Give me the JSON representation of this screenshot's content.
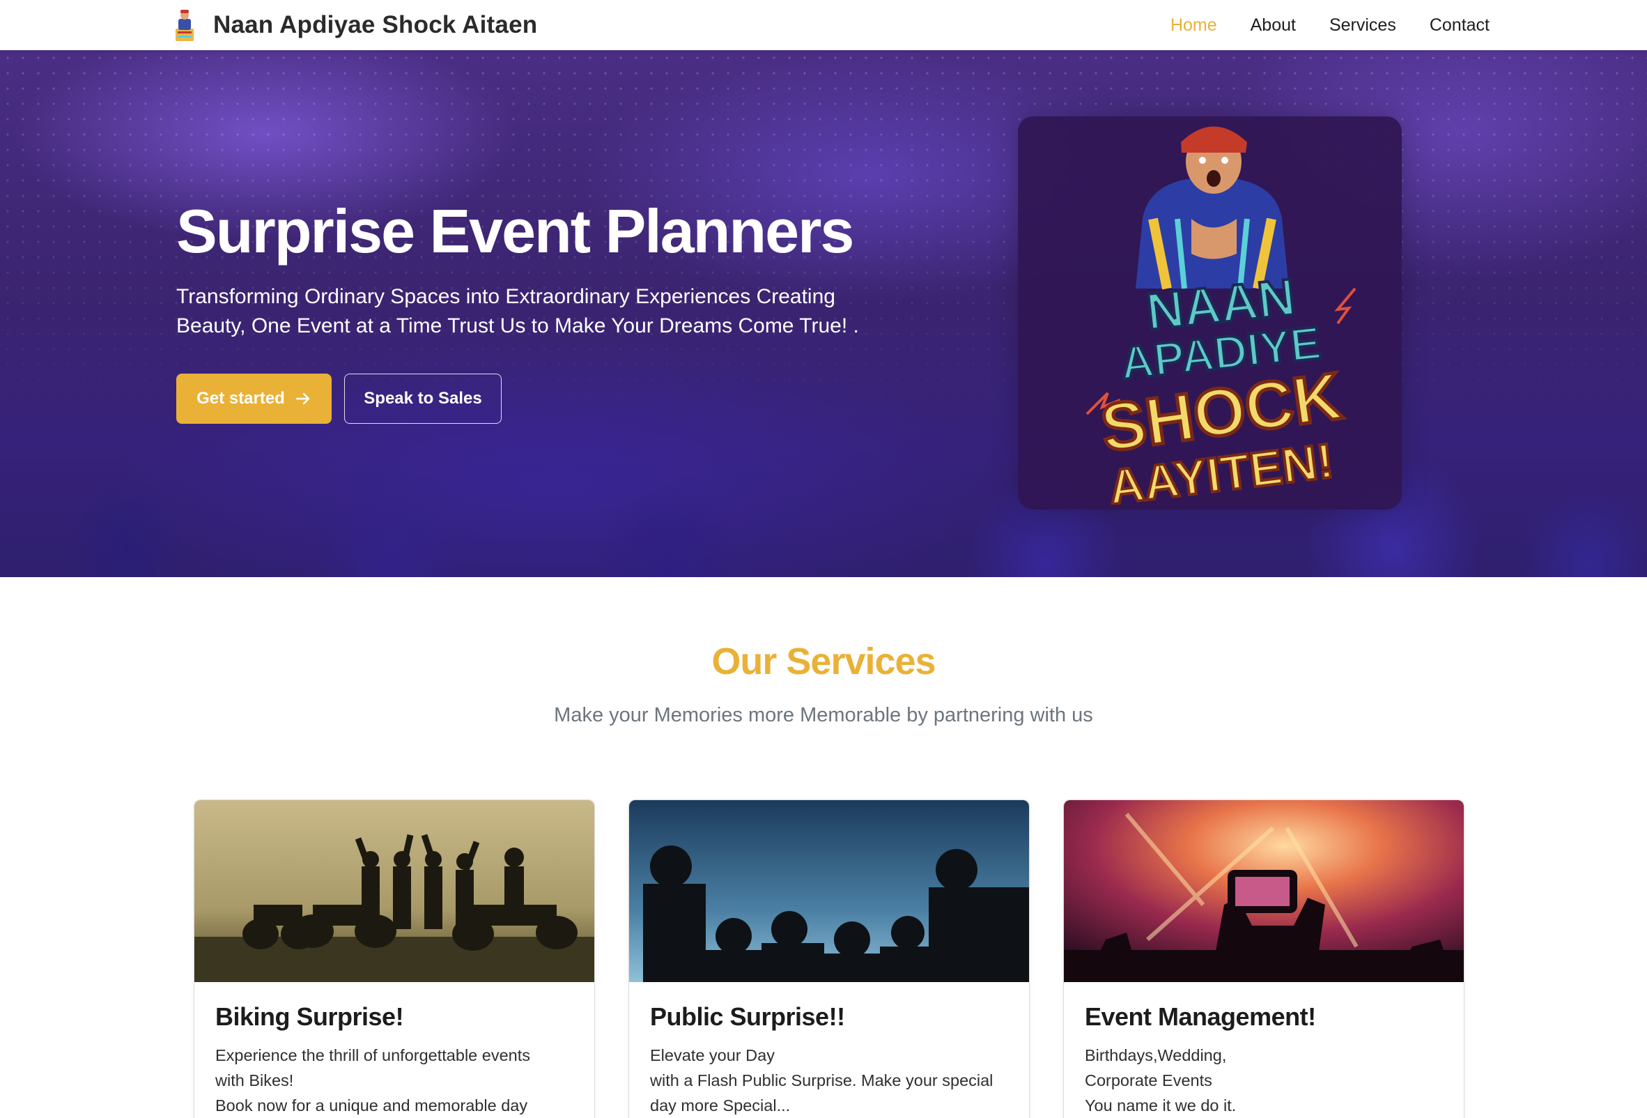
{
  "navbar": {
    "brand_name": "Naan Apdiyae Shock Aitaen",
    "links": [
      {
        "label": "Home",
        "active": true
      },
      {
        "label": "About",
        "active": false
      },
      {
        "label": "Services",
        "active": false
      },
      {
        "label": "Contact",
        "active": false
      }
    ]
  },
  "hero": {
    "title": "Surprise Event Planners",
    "subtitle": "Transforming Ordinary Spaces into Extraordinary Experiences Creating Beauty, One Event at a Time Trust Us to Make Your Dreams Come True! .",
    "primary_button": "Get started",
    "secondary_button": "Speak to Sales",
    "logo_lines": [
      "NAAN",
      "APADIYE",
      "SHOCK",
      "AAYITEN!"
    ]
  },
  "services": {
    "title": "Our Services",
    "subtitle": "Make your Memories more Memorable by partnering with us",
    "cards": [
      {
        "title": "Biking Surprise!",
        "lines": [
          "Experience the thrill of unforgettable events",
          "with Bikes!",
          "Book now for a unique and memorable day"
        ]
      },
      {
        "title": "Public Surprise!!",
        "lines": [
          "Elevate your Day",
          "with a Flash Public Surprise. Make your special",
          "day more Special..."
        ]
      },
      {
        "title": "Event Management!",
        "lines": [
          "Birthdays,Wedding,",
          "Corporate Events",
          "You name it we do it."
        ]
      }
    ]
  },
  "colors": {
    "accent": "#eab137",
    "hero_bg": "#3b2470",
    "hero_card": "#301652",
    "muted_text": "#6c757d"
  },
  "icons": {
    "brand": "brand-mascot-icon",
    "arrow": "arrow-right-icon"
  }
}
